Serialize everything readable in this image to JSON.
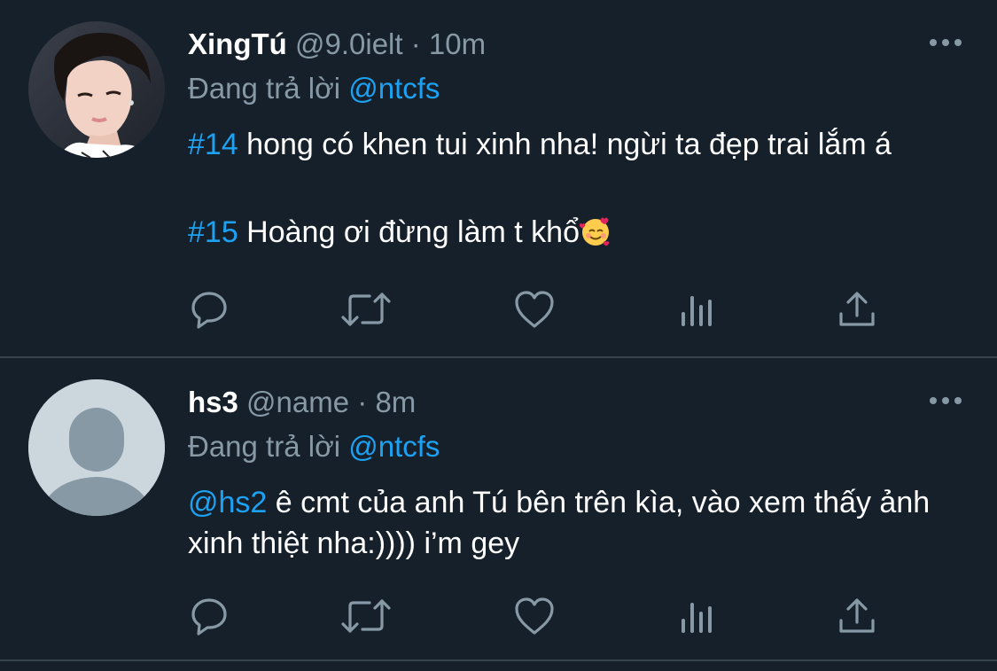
{
  "tweets": [
    {
      "display_name": "XingTú",
      "handle": "@9.0ielt",
      "separator": "·",
      "time": "10m",
      "reply_prefix": "Đang trả lời",
      "reply_to": "@ntcfs",
      "lines": [
        {
          "tag": "#14",
          "text": " hong có khen tui xinh nha! ngừi ta đẹp trai lắm á"
        },
        {
          "tag": "#15",
          "text": " Hoàng ơi đừng làm t khổ",
          "emoji": "🥰"
        }
      ]
    },
    {
      "display_name": "hs3",
      "handle": "@name",
      "separator": "·",
      "time": "8m",
      "reply_prefix": "Đang trả lời",
      "reply_to": "@ntcfs",
      "lines": [
        {
          "tag": "@hs2",
          "text": " ê cmt của anh Tú bên trên kìa, vào xem thấy ảnh xinh thiệt nha:)))) i’m gey"
        }
      ]
    }
  ],
  "icons": {
    "more": "more-horizontal-icon",
    "reply": "reply-bubble-icon",
    "retweet": "retweet-icon",
    "like": "heart-icon",
    "analytics": "analytics-bars-icon",
    "share": "share-upload-icon"
  },
  "colors": {
    "background": "#15202b",
    "divider": "#38444d",
    "accent": "#1da1f2",
    "secondary_text": "#8899a6",
    "primary_text": "#ffffff"
  }
}
